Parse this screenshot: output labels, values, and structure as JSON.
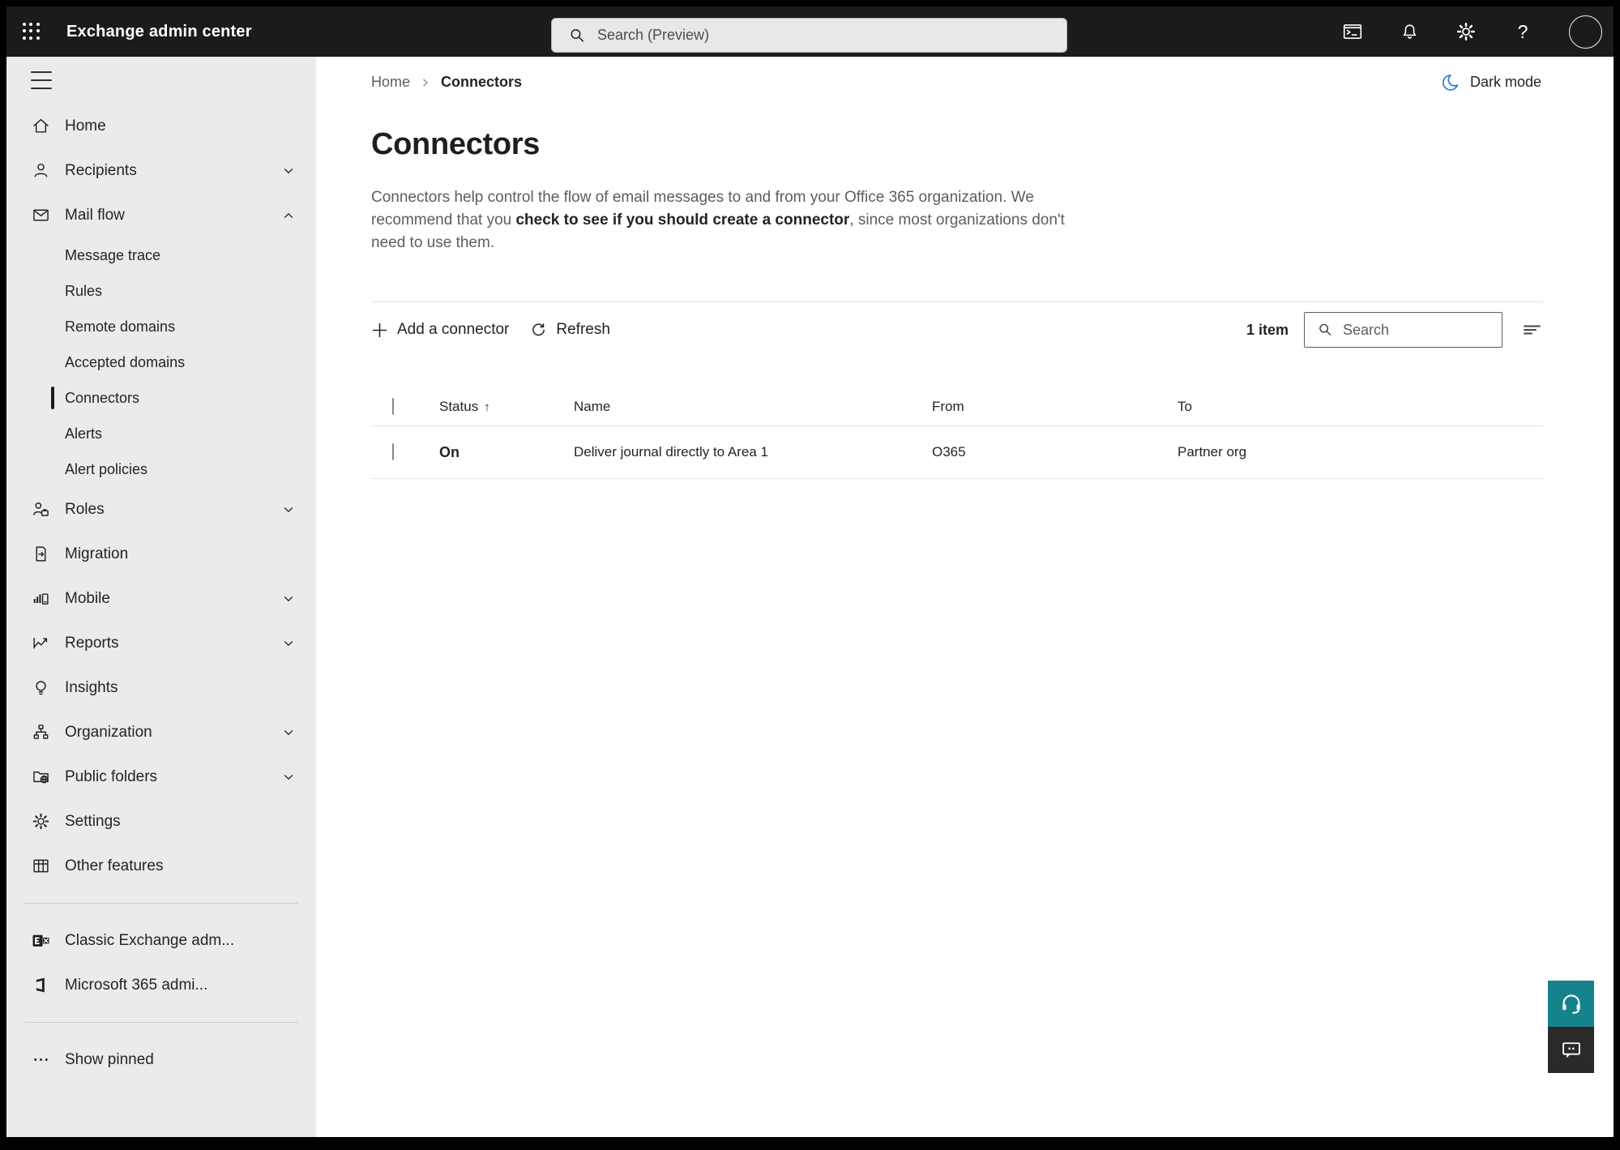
{
  "topbar": {
    "title": "Exchange admin center",
    "search_placeholder": "Search (Preview)",
    "icon_names": [
      "app-launcher",
      "terminal",
      "notifications",
      "settings",
      "help",
      "account"
    ]
  },
  "sidebar": {
    "items": [
      {
        "label": "Home",
        "icon": "home"
      },
      {
        "label": "Recipients",
        "icon": "person",
        "chevron": "down"
      },
      {
        "label": "Mail flow",
        "icon": "mail",
        "chevron": "up",
        "expanded": true
      },
      {
        "label": "Message trace",
        "sub": true
      },
      {
        "label": "Rules",
        "sub": true
      },
      {
        "label": "Remote domains",
        "sub": true
      },
      {
        "label": "Accepted domains",
        "sub": true
      },
      {
        "label": "Connectors",
        "sub": true,
        "selected": true
      },
      {
        "label": "Alerts",
        "sub": true
      },
      {
        "label": "Alert policies",
        "sub": true
      },
      {
        "label": "Roles",
        "icon": "person-badge",
        "chevron": "down"
      },
      {
        "label": "Migration",
        "icon": "document-arrow"
      },
      {
        "label": "Mobile",
        "icon": "mobile-chart",
        "chevron": "down"
      },
      {
        "label": "Reports",
        "icon": "line-chart",
        "chevron": "down"
      },
      {
        "label": "Insights",
        "icon": "lightbulb"
      },
      {
        "label": "Organization",
        "icon": "org-chart",
        "chevron": "down"
      },
      {
        "label": "Public folders",
        "icon": "folder-globe",
        "chevron": "down"
      },
      {
        "label": "Settings",
        "icon": "gear"
      },
      {
        "label": "Other features",
        "icon": "table-grid"
      },
      {
        "label": "Classic Exchange adm...",
        "icon": "exchange-logo"
      },
      {
        "label": "Microsoft 365 admi...",
        "icon": "office-logo"
      },
      {
        "label": "Show pinned",
        "icon": "ellipsis"
      }
    ]
  },
  "breadcrumb": {
    "home": "Home",
    "current": "Connectors"
  },
  "header_actions": {
    "dark_mode_label": "Dark mode"
  },
  "page": {
    "title": "Connectors",
    "description_before": "Connectors help control the flow of email messages to and from your Office 365 organization. We recommend that you ",
    "description_link": "check to see if you should create a connector",
    "description_after": ", since most organizations don't need to use them."
  },
  "toolbar": {
    "add_label": "Add a connector",
    "refresh_label": "Refresh",
    "count_label": "1 item",
    "search_placeholder": "Search"
  },
  "table": {
    "headers": {
      "status": "Status",
      "name": "Name",
      "from": "From",
      "to": "To"
    },
    "sort": {
      "column": "Status",
      "direction": "ascending",
      "arrow": "↑"
    },
    "rows": [
      {
        "status": "On",
        "name": "Deliver journal directly to Area 1",
        "from": "O365",
        "to": "Partner org"
      }
    ]
  },
  "floating_buttons": {
    "icon_names": [
      "headset-support",
      "feedback-bubble"
    ]
  },
  "colors": {
    "topbar_bg": "#1c1b1a",
    "sidebar_bg": "#ebebeb",
    "accent_blue": "#2b7cd3",
    "support_teal": "#16828c",
    "feedback_dark": "#2b2a29"
  }
}
